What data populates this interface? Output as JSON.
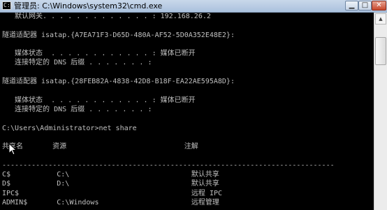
{
  "window": {
    "title": "管理员: C:\\Windows\\system32\\cmd.exe",
    "icon_text": "C:\\",
    "min_label": "▁",
    "max_label": "□",
    "close_label": "✕"
  },
  "console": {
    "lines": [
      "   默认网关. . . . . . . . . . . . . : 192.168.26.2",
      "",
      "隧道适配器 isatap.{A7EA71F3-D65D-480A-AF52-5D0A352E48E2}:",
      "",
      "   媒体状态  . . . . . . . . . . . . : 媒体已断开",
      "   连接特定的 DNS 后缀 . . . . . . . :",
      "",
      "隧道适配器 isatap.{28FEB82A-4838-42D8-B18F-EA22AE595A8D}:",
      "",
      "   媒体状态  . . . . . . . . . . . . : 媒体已断开",
      "   连接特定的 DNS 后缀 . . . . . . . :",
      "",
      "C:\\Users\\Administrator>net share",
      "",
      "共享名       资源                            注解",
      "",
      "-------------------------------------------------------------------------------",
      "C$           C:\\                             默认共享",
      "D$           D:\\                             默认共享",
      "IPC$                                         远程 IPC",
      "ADMIN$       C:\\Windows                      远程管理"
    ]
  },
  "scrollbar": {
    "up_arrow": "▲"
  },
  "icons": {
    "app": "cmd-icon",
    "cursor": "mouse-pointer-icon"
  }
}
